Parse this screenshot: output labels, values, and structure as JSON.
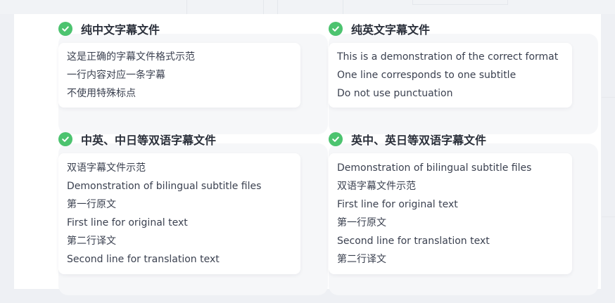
{
  "colors": {
    "check": "#4cc36f",
    "title": "#2a2f3a",
    "text": "#3b4150"
  },
  "sections": [
    {
      "icon": "check-circle-icon",
      "title": "纯中文字幕文件",
      "lines": [
        "这是正确的字幕文件格式示范",
        "一行内容对应一条字幕",
        "不使用特殊标点"
      ]
    },
    {
      "icon": "check-circle-icon",
      "title": "纯英文字幕文件",
      "lines": [
        "This is a demonstration of the correct format",
        "One line corresponds to one subtitle",
        "Do not use punctuation"
      ]
    },
    {
      "icon": "check-circle-icon",
      "title": "中英、中日等双语字幕文件",
      "lines": [
        "双语字幕文件示范",
        "Demonstration of bilingual subtitle files",
        "第一行原文",
        "First line for original text",
        "第二行译文",
        "Second line for translation text"
      ]
    },
    {
      "icon": "check-circle-icon",
      "title": "英中、英日等双语字幕文件",
      "lines": [
        "Demonstration of bilingual subtitle files",
        "双语字幕文件示范",
        "First line for original text",
        "第一行原文",
        "Second line for translation text",
        "第二行译文"
      ]
    }
  ]
}
